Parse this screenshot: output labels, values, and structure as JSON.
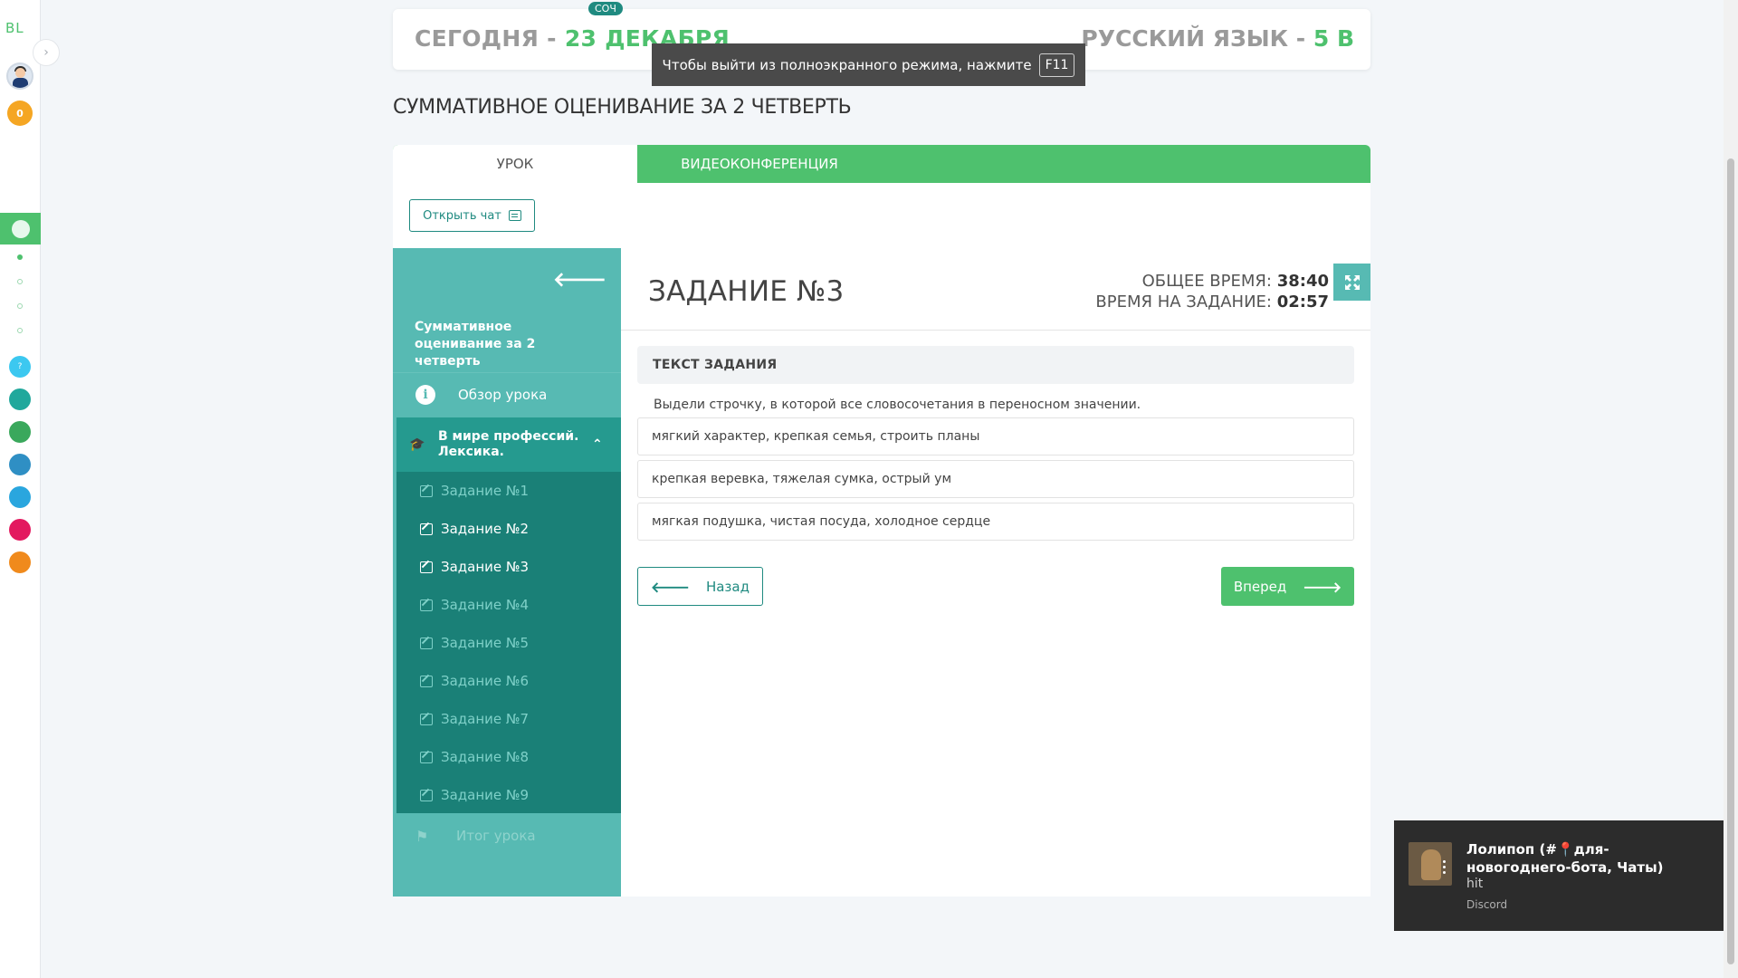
{
  "rail": {
    "logo": "BL",
    "coins": "0"
  },
  "header": {
    "date_prefix": "СЕГОДНЯ - ",
    "date_value": "23 ДЕКАБРЯ",
    "subject_prefix": "РУССКИЙ ЯЗЫК - ",
    "subject_value": "5 В",
    "badge": "СОЧ"
  },
  "fullscreen_toast": {
    "text": "Чтобы выйти из полноэкранного режима, нажмите",
    "key": "F11"
  },
  "page_heading": "СУММАТИВНОЕ ОЦЕНИВАНИЕ ЗА 2 ЧЕТВЕРТЬ",
  "tabs": [
    {
      "label": "УРОК",
      "active": true
    },
    {
      "label": "ВИДЕОКОНФЕРЕНЦИЯ",
      "active": false
    }
  ],
  "chat_button": "Открыть чат",
  "sidebar": {
    "course_title": "Суммативное оценивание за 2 четверть",
    "overview": "Обзор урока",
    "section": "В мире профессий. Лексика.",
    "tasks": [
      {
        "label": "Задание №1",
        "done": false
      },
      {
        "label": "Задание №2",
        "done": true
      },
      {
        "label": "Задание №3",
        "done": true
      },
      {
        "label": "Задание №4",
        "done": false
      },
      {
        "label": "Задание №5",
        "done": false
      },
      {
        "label": "Задание №6",
        "done": false
      },
      {
        "label": "Задание №7",
        "done": false
      },
      {
        "label": "Задание №8",
        "done": false
      },
      {
        "label": "Задание №9",
        "done": false
      }
    ],
    "summary": "Итог урока"
  },
  "content": {
    "task_title": "ЗАДАНИЕ №3",
    "total_time_label": "ОБЩЕЕ ВРЕМЯ: ",
    "total_time": "38:40",
    "task_time_label": "ВРЕМЯ НА ЗАДАНИЕ: ",
    "task_time": "02:57",
    "task_header": "ТЕКСТ ЗАДАНИЯ",
    "question": "Выдели строчку, в которой все словосочетания в переносном значении.",
    "options": [
      "мягкий характер, крепкая семья, строить планы",
      "крепкая веревка, тяжелая сумка, острый ум",
      "мягкая подушка, чистая посуда, холодное сердце"
    ],
    "back_button": "Назад",
    "next_button": "Вперед"
  },
  "notification": {
    "title": "Лолипоп (#📍для-новогоднего-бота, Чаты)",
    "message": "hit",
    "app": "Discord"
  },
  "colors": {
    "accent_green": "#4ec16e",
    "teal": "#57bab3",
    "dark_teal": "#1a8077"
  }
}
